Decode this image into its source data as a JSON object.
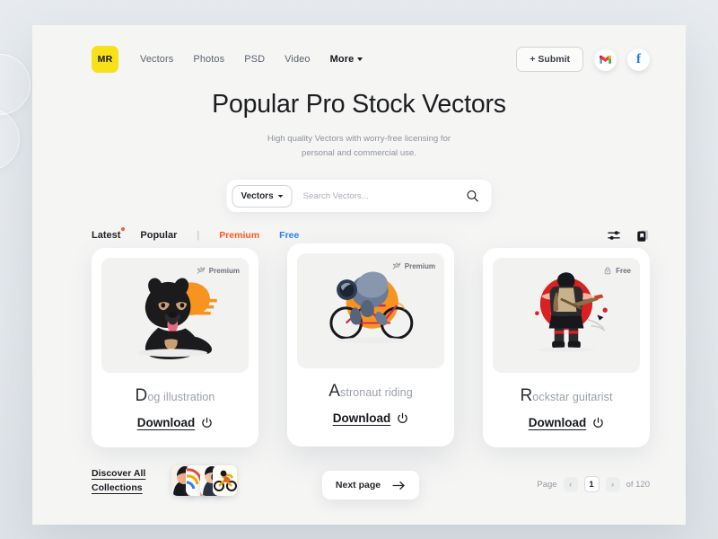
{
  "brand": {
    "logo_text": "MR"
  },
  "nav": {
    "items": [
      {
        "label": "Vectors",
        "strong": false
      },
      {
        "label": "Photos",
        "strong": false
      },
      {
        "label": "PSD",
        "strong": false
      },
      {
        "label": "Video",
        "strong": false
      },
      {
        "label": "More",
        "strong": true
      }
    ]
  },
  "header": {
    "submit_label": "+ Submit",
    "gmail_icon": "gmail-icon",
    "facebook_icon": "facebook-icon",
    "facebook_glyph": "f"
  },
  "hero": {
    "title": "Popular Pro Stock Vectors",
    "subtitle_line1": "High quality Vectors with worry-free licensing for",
    "subtitle_line2": "personal and commercial use."
  },
  "search": {
    "category_value": "Vectors",
    "placeholder": "Search Vectors...",
    "value": "",
    "search_icon": "search-icon"
  },
  "filters": {
    "latest": "Latest",
    "popular": "Popular",
    "divider": "|",
    "premium": "Premium",
    "free": "Free",
    "premium_color": "#ff5b22",
    "free_color": "#2d7ff9",
    "badge_dot_color": "#ff5b22",
    "sliders_icon": "sliders-icon",
    "collections_icon": "collections-bookmark-icon"
  },
  "cards": [
    {
      "badge_label": "Premium",
      "badge_icon": "crown-icon",
      "title_initial": "D",
      "title_rest": "og illustration",
      "download_label": "Download",
      "download_icon": "power-download-icon",
      "art": "dog-illustration-art",
      "raised": false
    },
    {
      "badge_label": "Premium",
      "badge_icon": "crown-icon",
      "title_initial": "A",
      "title_rest": "stronaut riding",
      "download_label": "Download",
      "download_icon": "power-download-icon",
      "art": "astronaut-riding-art",
      "raised": true
    },
    {
      "badge_label": "Free",
      "badge_icon": "lock-icon",
      "title_initial": "R",
      "title_rest": "ockstar guitarist",
      "download_label": "Download",
      "download_icon": "power-download-icon",
      "art": "rockstar-guitarist-art",
      "raised": false
    }
  ],
  "footer": {
    "discover_line1": "Discover All",
    "discover_line2": "Collections",
    "next_page_label": "Next page",
    "next_arrow_icon": "arrow-right-icon",
    "page_label": "Page",
    "prev_icon": "chevron-left-icon",
    "next_icon": "chevron-right-icon",
    "current_page": "1",
    "total_label": "of 120"
  }
}
